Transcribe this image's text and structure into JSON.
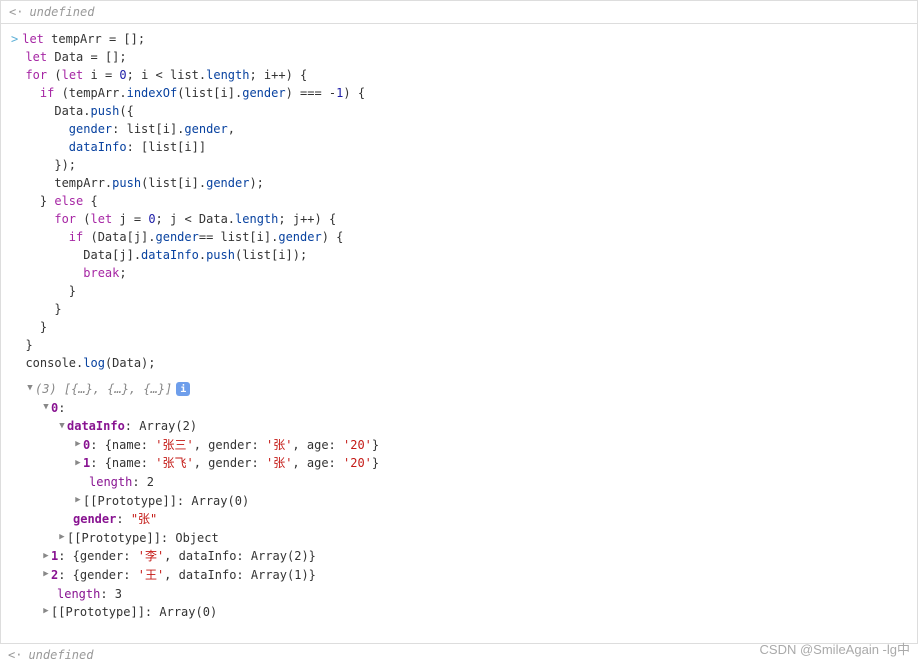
{
  "header": {
    "undefined": "undefined"
  },
  "footer": {
    "undefined": "undefined"
  },
  "code": {
    "l1a": "let",
    "l1b": " tempArr = [];",
    "l2a": "let",
    "l2b": " Data = [];",
    "l3a": "for",
    "l3b": " (",
    "l3c": "let",
    "l3d": " i = ",
    "l3e": "0",
    "l3f": "; i < list.",
    "l3g": "length",
    "l3h": "; i++) {",
    "l4a": "    ",
    "l4b": "if",
    "l4c": " (tempArr.",
    "l4d": "indexOf",
    "l4e": "(list[i].",
    "l4f": "gender",
    "l4g": ") === -",
    "l4h": "1",
    "l4i": ") {",
    "l5a": "      Data.",
    "l5b": "push",
    "l5c": "({",
    "l6a": "        ",
    "l6b": "gender",
    "l6c": ": list[i].",
    "l6d": "gender",
    "l6e": ",",
    "l7a": "        ",
    "l7b": "dataInfo",
    "l7c": ": [list[i]]",
    "l8": "      });",
    "l9a": "      tempArr.",
    "l9b": "push",
    "l9c": "(list[i].",
    "l9d": "gender",
    "l9e": ");",
    "l10a": "    } ",
    "l10b": "else",
    "l10c": " {",
    "l11a": "      ",
    "l11b": "for",
    "l11c": " (",
    "l11d": "let",
    "l11e": " j = ",
    "l11f": "0",
    "l11g": "; j < Data.",
    "l11h": "length",
    "l11i": "; j++) {",
    "l12a": "        ",
    "l12b": "if",
    "l12c": " (Data[j].",
    "l12d": "gender",
    "l12e": "== list[i].",
    "l12f": "gender",
    "l12g": ") {",
    "l13a": "          Data[j].",
    "l13b": "dataInfo",
    "l13c": ".",
    "l13d": "push",
    "l13e": "(list[i]);",
    "l14a": "          ",
    "l14b": "break",
    "l14c": ";",
    "l15": "        }",
    "l16": "      }",
    "l17": "    }",
    "l18": "  }",
    "l19a": "  console.",
    "l19b": "log",
    "l19c": "(Data);"
  },
  "output": {
    "summary": "(3) [{…}, {…}, {…}]",
    "info": "i",
    "item0": {
      "key": "0",
      "colon": ":"
    },
    "dataInfo": {
      "key": "dataInfo",
      "val": ": Array(2)"
    },
    "di0": {
      "key": "0",
      "colon": ": ",
      "open": "{name: ",
      "name": "'张三'",
      "mid1": ", gender: ",
      "gender": "'张'",
      "mid2": ", age: ",
      "age": "'20'",
      "close": "}"
    },
    "di1": {
      "key": "1",
      "colon": ": ",
      "open": "{name: ",
      "name": "'张飞'",
      "mid1": ", gender: ",
      "gender": "'张'",
      "mid2": ", age: ",
      "age": "'20'",
      "close": "}"
    },
    "len2": {
      "key": "length",
      "val": ": 2"
    },
    "proto_arr0_a": "[[Prototype]]: Array(0)",
    "gender": {
      "key": "gender",
      "colon": ": ",
      "val": "\"张\""
    },
    "proto_obj": "[[Prototype]]: Object",
    "item1": {
      "key": "1",
      "val": ": {gender: ",
      "g": "'李'",
      "rest": ", dataInfo: Array(2)}"
    },
    "item2": {
      "key": "2",
      "val": ": {gender: ",
      "g": "'王'",
      "rest": ", dataInfo: Array(1)}"
    },
    "len3": {
      "key": "length",
      "val": ": 3"
    },
    "proto_arr0_b": "[[Prototype]]: Array(0)"
  },
  "watermark": "CSDN @SmileAgain -lg中"
}
